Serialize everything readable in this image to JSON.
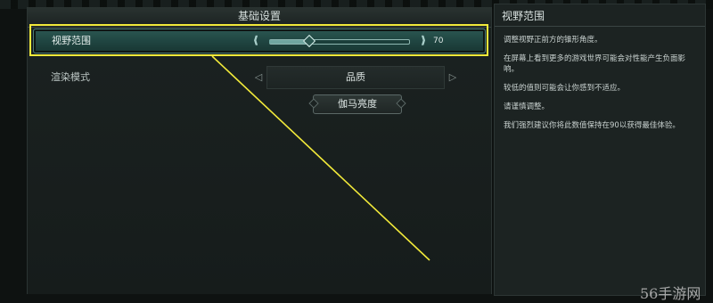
{
  "settings_panel": {
    "title": "基础设置",
    "fov": {
      "label": "视野范围",
      "value": "70",
      "value_fraction": 0.28
    },
    "render_mode": {
      "label": "渲染模式",
      "value": "品质",
      "page_index": 0,
      "page_count": 2
    },
    "gamma_button_label": "伽马亮度"
  },
  "info_panel": {
    "title": "视野范围",
    "paragraphs": [
      "调整视野正前方的锥形角度。",
      "在屏幕上看到更多的游戏世界可能会对性能产生负面影响。",
      "较低的值则可能会让你感到不适应。",
      "请谨慎调整。",
      "我们强烈建议你将此数值保持在90以获得最佳体验。"
    ]
  },
  "annotation": {
    "color": "#f2ea3a"
  },
  "watermark": "56手游网",
  "colors": {
    "accent_row": "#1f4440",
    "highlight": "#f2ea3a"
  },
  "icons": {
    "slider_left": "chevrons-left-icon",
    "slider_right": "chevrons-right-icon",
    "selector_left": "triangle-left-icon",
    "selector_right": "triangle-right-icon"
  }
}
